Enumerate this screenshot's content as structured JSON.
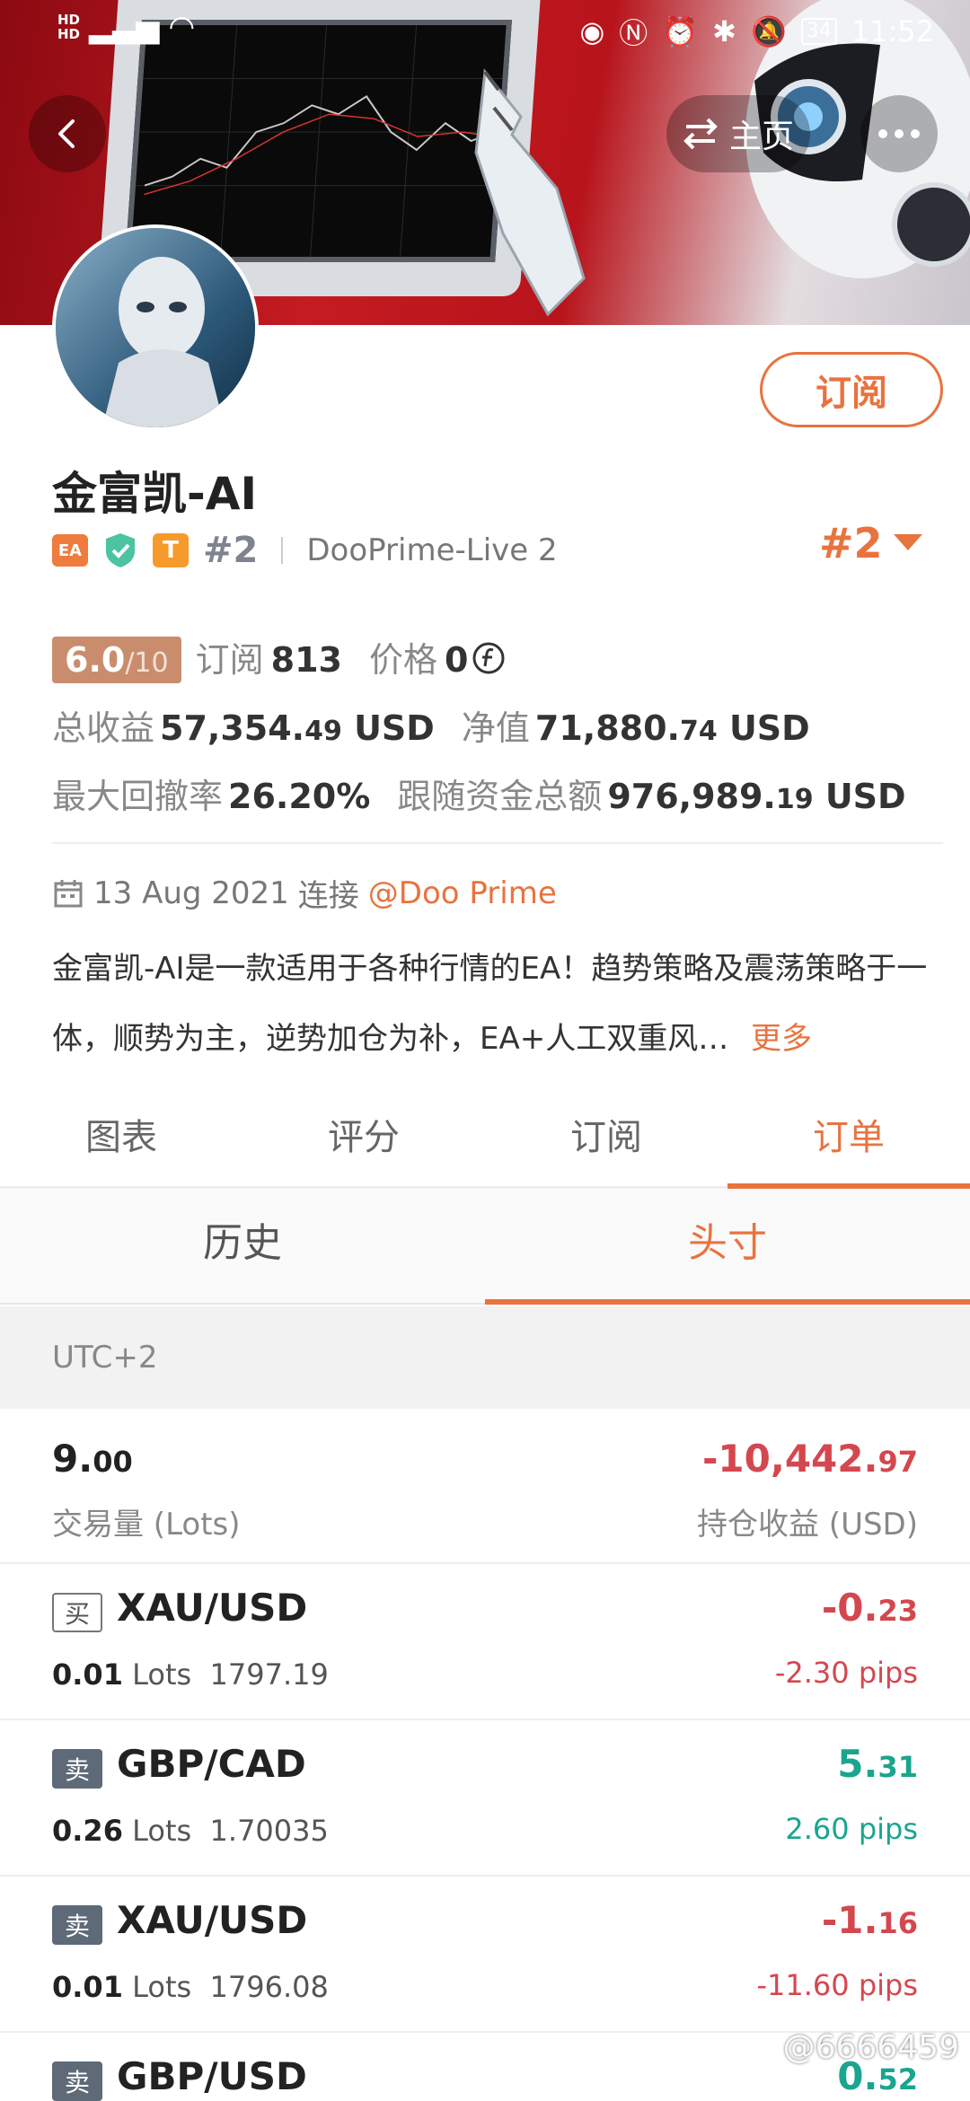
{
  "status_bar": {
    "time": "11:52",
    "battery": "34",
    "hd1": "HD",
    "hd2": "HD"
  },
  "header": {
    "home_label": "主页"
  },
  "profile": {
    "name": "金富凯-AI",
    "subscribe_label": "订阅",
    "badge_ea": "EA",
    "badge_t": "T",
    "rank_small": "#2",
    "server": "DooPrime-Live 2",
    "rank_large": "#2"
  },
  "stats": {
    "score": "6.0",
    "score_of": "/10",
    "subscribe_label": "订阅",
    "subscribe_count": "813",
    "price_label": "价格",
    "price_value": "0",
    "total_profit_label": "总收益",
    "total_profit_int": "57,354.",
    "total_profit_dec": "49",
    "total_profit_unit": "USD",
    "equity_label": "净值",
    "equity_int": "71,880.",
    "equity_dec": "74",
    "equity_unit": "USD",
    "max_drawdown_label": "最大回撤率",
    "max_drawdown_value": "26.20%",
    "follow_funds_label": "跟随资金总额",
    "follow_funds_int": "976,989.",
    "follow_funds_dec": "19",
    "follow_funds_unit": "USD"
  },
  "connect": {
    "date": "13 Aug 2021",
    "connect_label": "连接",
    "broker": "@Doo Prime"
  },
  "description": {
    "text": "金富凯-AI是一款适用于各种行情的EA！趋势策略及震荡策略于一体，顺势为主，逆势加仓为补，EA+人工双重风…",
    "more": "更多"
  },
  "tabs": [
    {
      "label": "图表"
    },
    {
      "label": "评分"
    },
    {
      "label": "订阅"
    },
    {
      "label": "订单"
    }
  ],
  "subtabs": [
    {
      "label": "历史"
    },
    {
      "label": "头寸"
    }
  ],
  "timezone": "UTC+2",
  "summary": {
    "lots_int": "9.",
    "lots_dec": "00",
    "lots_label": "交易量 (Lots)",
    "pnl_int": "-10,442.",
    "pnl_dec": "97",
    "pnl_label": "持仓收益 (USD)"
  },
  "positions": [
    {
      "side": "买",
      "symbol": "XAU/USD",
      "lots": "0.01",
      "lots_unit": "Lots",
      "price": "1797.19",
      "pnl_int": "-0.",
      "pnl_dec": "23",
      "pips": "-2.30 pips"
    },
    {
      "side": "卖",
      "symbol": "GBP/CAD",
      "lots": "0.26",
      "lots_unit": "Lots",
      "price": "1.70035",
      "pnl_int": "5.",
      "pnl_dec": "31",
      "pips": "2.60 pips"
    },
    {
      "side": "卖",
      "symbol": "XAU/USD",
      "lots": "0.01",
      "lots_unit": "Lots",
      "price": "1796.08",
      "pnl_int": "-1.",
      "pnl_dec": "16",
      "pips": "-11.60 pips"
    },
    {
      "side": "卖",
      "symbol": "GBP/USD",
      "lots": "",
      "lots_unit": "",
      "price": "",
      "pnl_int": "0.",
      "pnl_dec": "52",
      "pips": ""
    }
  ],
  "watermark": "@6666459",
  "colors": {
    "accent": "#e8733f",
    "negative": "#d4474f",
    "positive": "#1aa58f",
    "banner_red": "#c51b22"
  },
  "icons": {
    "back": "back-arrow-icon",
    "swap": "swap-arrows-icon",
    "more": "more-dots-icon",
    "calendar": "calendar-icon",
    "verified": "shield-check-icon",
    "dropdown": "triangle-down-icon",
    "currency": "currency-f-icon"
  }
}
